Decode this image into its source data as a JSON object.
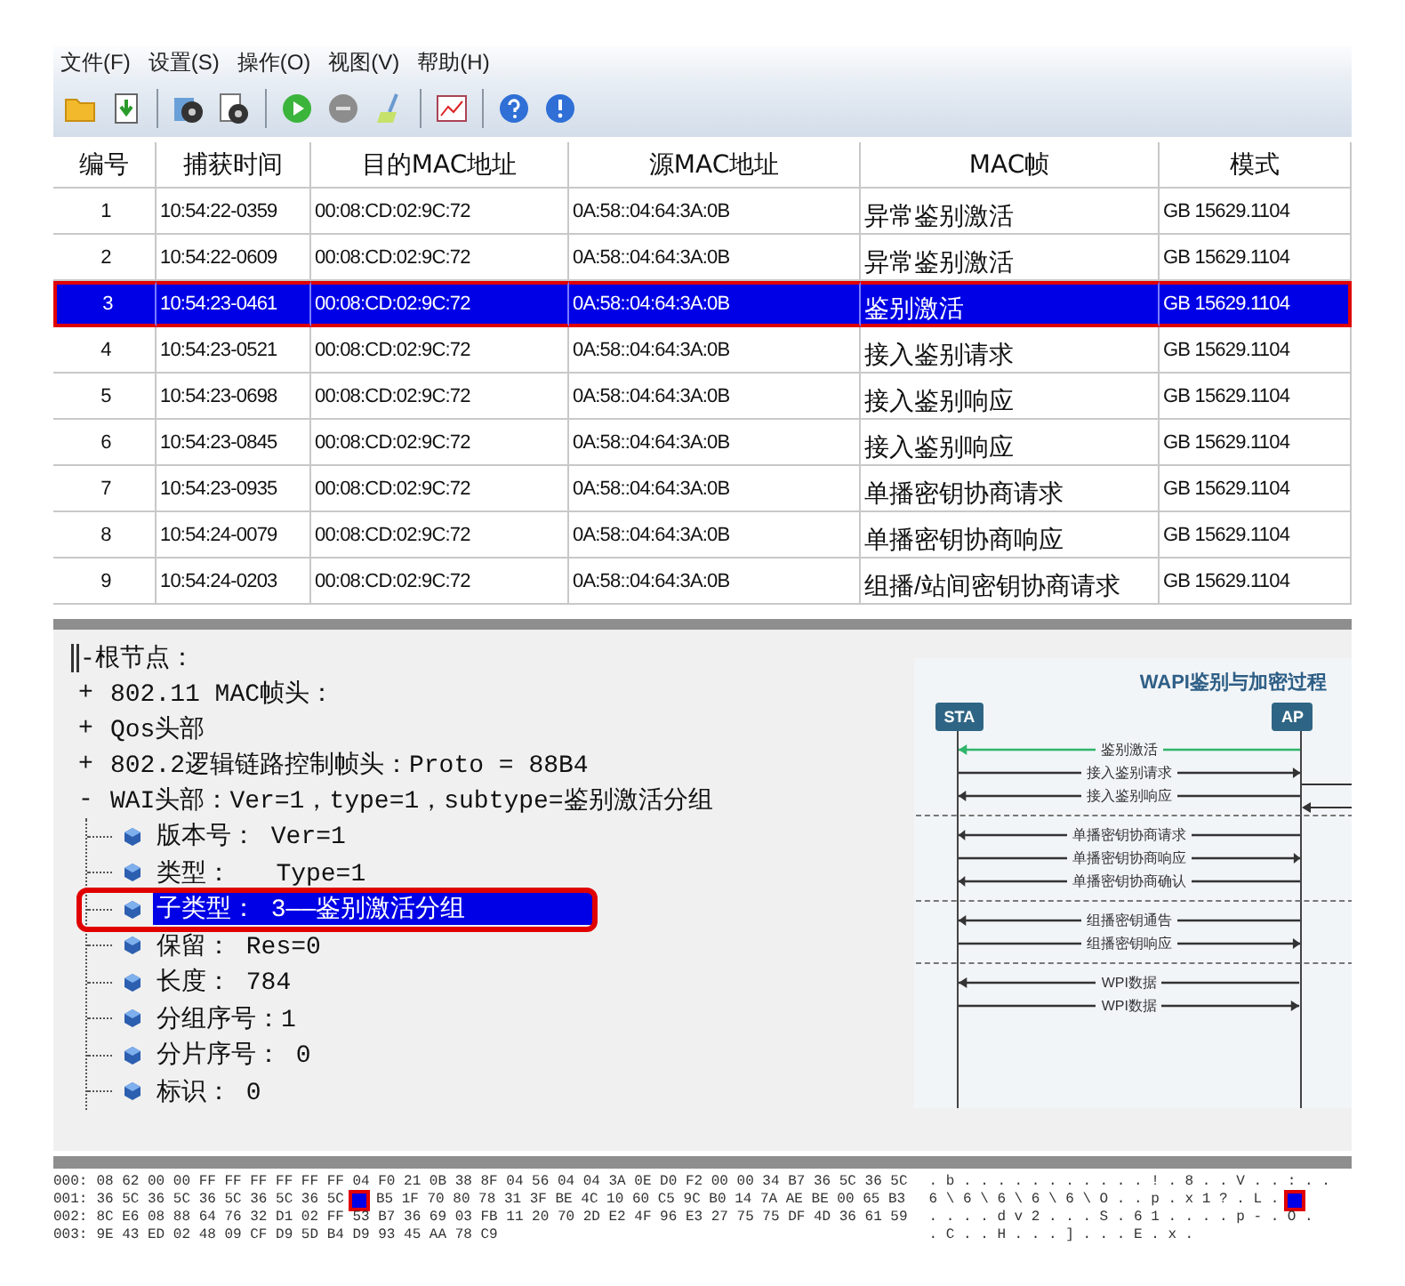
{
  "menu": [
    "文件(F)",
    "设置(S)",
    "操作(O)",
    "视图(V)",
    "帮助(H)"
  ],
  "toolbar": [
    {
      "kind": "folder"
    },
    {
      "kind": "import"
    },
    {
      "kind": "sep"
    },
    {
      "kind": "disc"
    },
    {
      "kind": "disc-doc"
    },
    {
      "kind": "sep"
    },
    {
      "kind": "play"
    },
    {
      "kind": "stop"
    },
    {
      "kind": "broom"
    },
    {
      "kind": "sep"
    },
    {
      "kind": "chart"
    },
    {
      "kind": "sep"
    },
    {
      "kind": "help"
    },
    {
      "kind": "info"
    }
  ],
  "table": {
    "columns": [
      "编号",
      "捕获时间",
      "目的MAC地址",
      "源MAC地址",
      "MAC帧",
      "模式"
    ],
    "rows": [
      {
        "cells": [
          "1",
          "10:54:22-0359",
          "00:08:CD:02:9C:72",
          "0A:58::04:64:3A:0B",
          "异常鉴别激活",
          "GB 15629.1104"
        ],
        "selected": false
      },
      {
        "cells": [
          "2",
          "10:54:22-0609",
          "00:08:CD:02:9C:72",
          "0A:58::04:64:3A:0B",
          "异常鉴别激活",
          "GB 15629.1104"
        ],
        "selected": false
      },
      {
        "cells": [
          "3",
          "10:54:23-0461",
          "00:08:CD:02:9C:72",
          "0A:58::04:64:3A:0B",
          "鉴别激活",
          "GB 15629.1104"
        ],
        "selected": true
      },
      {
        "cells": [
          "4",
          "10:54:23-0521",
          "00:08:CD:02:9C:72",
          "0A:58::04:64:3A:0B",
          "接入鉴别请求",
          "GB 15629.1104"
        ],
        "selected": false
      },
      {
        "cells": [
          "5",
          "10:54:23-0698",
          "00:08:CD:02:9C:72",
          "0A:58::04:64:3A:0B",
          "接入鉴别响应",
          "GB 15629.1104"
        ],
        "selected": false
      },
      {
        "cells": [
          "6",
          "10:54:23-0845",
          "00:08:CD:02:9C:72",
          "0A:58::04:64:3A:0B",
          "接入鉴别响应",
          "GB 15629.1104"
        ],
        "selected": false
      },
      {
        "cells": [
          "7",
          "10:54:23-0935",
          "00:08:CD:02:9C:72",
          "0A:58::04:64:3A:0B",
          "单播密钥协商请求",
          "GB 15629.1104"
        ],
        "selected": false
      },
      {
        "cells": [
          "8",
          "10:54:24-0079",
          "00:08:CD:02:9C:72",
          "0A:58::04:64:3A:0B",
          "单播密钥协商响应",
          "GB 15629.1104"
        ],
        "selected": false
      },
      {
        "cells": [
          "9",
          "10:54:24-0203",
          "00:08:CD:02:9C:72",
          "0A:58::04:64:3A:0B",
          "组播/站间密钥协商请求",
          "GB 15629.1104"
        ],
        "selected": false
      }
    ]
  },
  "tree": {
    "label": "-根节点：",
    "children": [
      {
        "sign": "+",
        "label": "802.11 MAC帧头："
      },
      {
        "sign": "+",
        "label": "Qos头部"
      },
      {
        "sign": "+",
        "label": "802.2逻辑链路控制帧头：Proto = 88B4"
      },
      {
        "sign": "-",
        "label": "WAI头部：Ver=1，type=1，subtype=鉴别激活分组",
        "children": [
          {
            "label": "版本号： Ver=1",
            "selected": false
          },
          {
            "label": "类型：   Type=1",
            "selected": false
          },
          {
            "label": "子类型： 3——鉴别激活分组",
            "selected": true
          },
          {
            "label": "保留： Res=0",
            "selected": false
          },
          {
            "label": "长度： 784",
            "selected": false
          },
          {
            "label": "分组序号：1",
            "selected": false
          },
          {
            "label": "分片序号： 0",
            "selected": false
          },
          {
            "label": "标识： 0",
            "selected": false
          }
        ]
      }
    ]
  },
  "diagram": {
    "title": "WAPI鉴别与加密过程",
    "left": "STA",
    "right": "AP",
    "messages": [
      {
        "kind": "msg",
        "label": "鉴别激活",
        "points_left": true,
        "color": "#2fb56a"
      },
      {
        "kind": "msg",
        "label": "接入鉴别请求",
        "points_left": false,
        "color": "#333333"
      },
      {
        "kind": "msg",
        "label": "接入鉴别响应",
        "points_left": true,
        "color": "#333333"
      },
      {
        "kind": "divider"
      },
      {
        "kind": "msg",
        "label": "单播密钥协商请求",
        "points_left": true,
        "color": "#333333"
      },
      {
        "kind": "msg",
        "label": "单播密钥协商响应",
        "points_left": false,
        "color": "#333333"
      },
      {
        "kind": "msg",
        "label": "单播密钥协商确认",
        "points_left": true,
        "color": "#333333"
      },
      {
        "kind": "divider"
      },
      {
        "kind": "msg",
        "label": "组播密钥通告",
        "points_left": true,
        "color": "#333333"
      },
      {
        "kind": "msg",
        "label": "组播密钥响应",
        "points_left": false,
        "color": "#333333"
      },
      {
        "kind": "divider"
      },
      {
        "kind": "msg",
        "label": "WPI数据",
        "points_left": true,
        "color": "#333333"
      },
      {
        "kind": "msg",
        "label": "WPI数据",
        "points_left": false,
        "color": "#333333"
      }
    ]
  },
  "hex": [
    {
      "offset": "000:",
      "bytes": "08 62 00 00 FF FF FF FF FF FF 04 F0 21 0B 38 8F 04 56 04 04 3A 0E D0 F2 00 00 34 B7 36 5C 36 5C",
      "cursor": false,
      "ascii": ". b . . . . . . . . . . . ! . 8 . . V . . : . ."
    },
    {
      "offset": "001:",
      "bytes": "36 5C 36 5C 36 5C 36 5C 36 5C",
      "cursor": true,
      "bytes_after": "B5 1F 70 80 78 31 3F BE 4C 10 60 C5 9C B0 14 7A AE BE 00 65 B3",
      "ascii": "6 \\ 6 \\ 6 \\ 6 \\ 6 \\ O . . p . x 1 ? . L ."
    },
    {
      "offset": "002:",
      "bytes": "8C E6 08 88 64 76 32 D1 02 FF 53 B7 36 69 03 FB 11 20 70 2D E2 4F 96 E3 27 75 75 DF 4D 36 61 59",
      "cursor": false,
      "ascii": ". . . . d v 2 . . . S . 6 1 . . . . p - . O ."
    },
    {
      "offset": "003:",
      "bytes": "9E 43 ED 02 48 09 CF D9 5D B4 D9 93 45 AA 78 C9",
      "cursor": false,
      "ascii": ". C . . H . . . ] . . . E . x ."
    }
  ]
}
